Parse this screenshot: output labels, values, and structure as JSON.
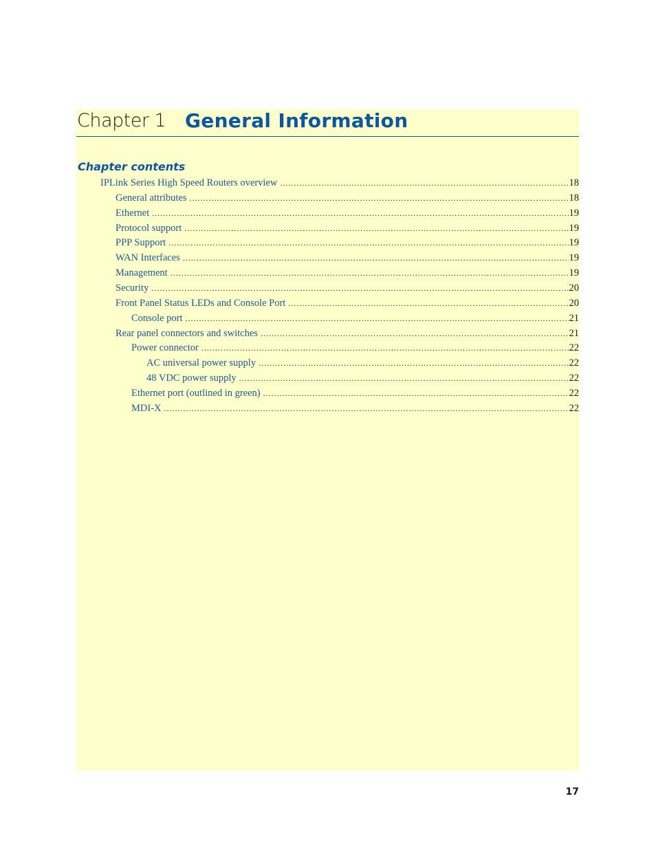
{
  "chapter": {
    "label": "Chapter 1",
    "title": "General Information"
  },
  "contents_heading": "Chapter contents",
  "toc": [
    {
      "label": "IPLink Series High Speed Routers overview",
      "page": "18",
      "level": 0
    },
    {
      "label": "General attributes",
      "page": "18",
      "level": 1
    },
    {
      "label": "Ethernet",
      "page": "19",
      "level": 1
    },
    {
      "label": "Protocol support",
      "page": "19",
      "level": 1
    },
    {
      "label": "PPP Support",
      "page": "19",
      "level": 1
    },
    {
      "label": "WAN Interfaces",
      "page": "19",
      "level": 1
    },
    {
      "label": "Management",
      "page": "19",
      "level": 1
    },
    {
      "label": "Security",
      "page": "20",
      "level": 1
    },
    {
      "label": "Front Panel Status LEDs and Console Port",
      "page": "20",
      "level": 1
    },
    {
      "label": "Console port",
      "page": "21",
      "level": 2
    },
    {
      "label": "Rear panel connectors and switches",
      "page": "21",
      "level": 1
    },
    {
      "label": "Power connector",
      "page": "22",
      "level": 2
    },
    {
      "label": "AC universal power supply",
      "page": "22",
      "level": 3
    },
    {
      "label": "48 VDC power supply",
      "page": "22",
      "level": 3
    },
    {
      "label": "Ethernet port (outlined in green)",
      "page": "22",
      "level": 2
    },
    {
      "label": "MDI-X",
      "page": "22",
      "level": 2
    }
  ],
  "page_number": "17",
  "colors": {
    "panel_background": "#ffffcc",
    "accent_blue": "#0a57a0",
    "link_blue": "#1a5a8c"
  }
}
